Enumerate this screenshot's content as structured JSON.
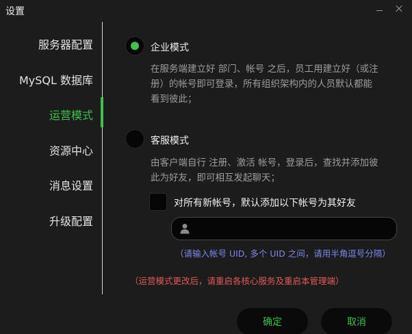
{
  "window": {
    "title": "设置"
  },
  "sidebar": {
    "items": [
      {
        "label": "服务器配置"
      },
      {
        "label": "MySQL 数据库"
      },
      {
        "label": "运营模式",
        "active": true
      },
      {
        "label": "资源中心"
      },
      {
        "label": "消息设置"
      },
      {
        "label": "升级配置"
      }
    ]
  },
  "mode": {
    "enterprise": {
      "label": "企业模式",
      "selected": true,
      "desc_lines": [
        "在服务端建立好 部门、帐号 之后，员工用建立好（或注",
        "册）的帐号即可登录，所有组织架构内的人员默认都能",
        "看到彼此；"
      ]
    },
    "customer": {
      "label": "客服模式",
      "selected": false,
      "desc_lines": [
        "由客户端自行 注册、激活 帐号，登录后，查找并添加彼",
        "此为好友，即可相互发起聊天；"
      ],
      "auto_friend_label": "对所有新帐号，默认添加以下帐号为其好友",
      "auto_friend_checked": false,
      "uid_input_value": "",
      "uid_hint": "（请输入帐号 UID, 多个 UID 之间，请用半角逗号分隔）"
    }
  },
  "warning": "（运营模式更改后，请重启各核心服务及重启本管理端）",
  "footer": {
    "confirm_label": "确定",
    "cancel_label": "取消"
  },
  "colors": {
    "accent": "#3fc14a",
    "hint": "#7d87ee",
    "warning": "#e45757",
    "background": "#1c1c1c"
  }
}
